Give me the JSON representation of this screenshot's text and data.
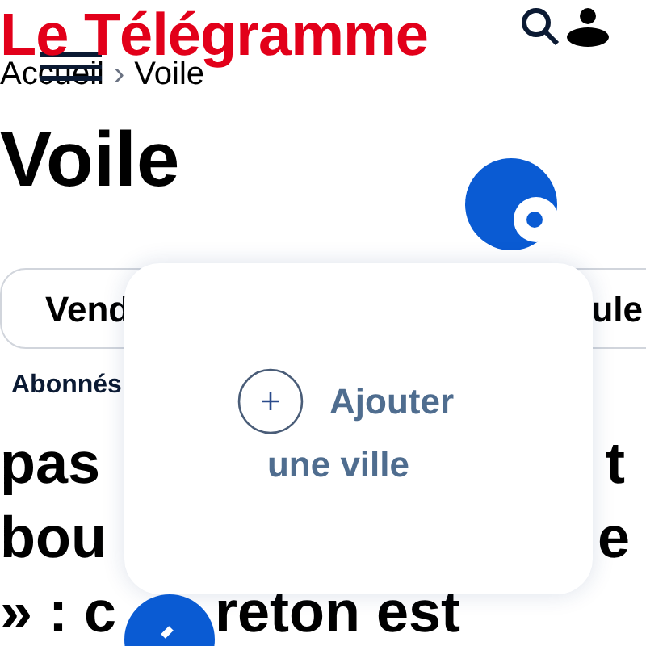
{
  "header": {
    "logo": "Le Télégramme"
  },
  "breadcrumb": [
    {
      "label": "Accueil"
    },
    {
      "label": "›"
    },
    {
      "label": "Voile"
    }
  ],
  "title": "Voile",
  "filters": [
    {
      "label": "Vend"
    },
    {
      "label": "ule"
    }
  ],
  "subscriber_label": "Abonnés",
  "headline_lines": [
    {
      "left": "pas",
      "right": "t"
    },
    {
      "left": "bou",
      "right": "e"
    },
    {
      "left": "» : c",
      "right": "reton est"
    }
  ],
  "popup": {
    "action_1": "Ajouter",
    "action_2": "une ville"
  }
}
